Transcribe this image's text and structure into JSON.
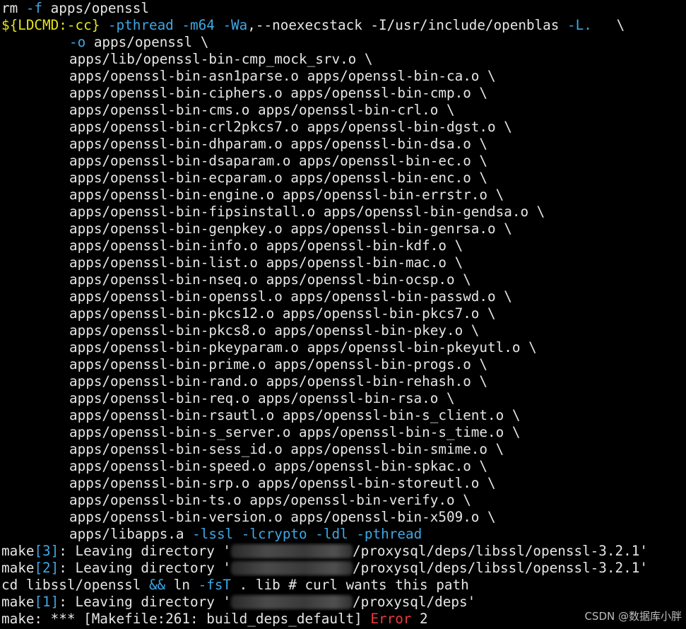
{
  "colors": {
    "background": "#000000",
    "text": "#e6e6e6",
    "flag": "#3ea8e5",
    "variable": "#e5e51a",
    "error": "#e8393c"
  },
  "line1": {
    "cmd": "rm",
    "flag": "-f",
    "arg": "apps/openssl"
  },
  "line2": {
    "var": "${LDCMD:-cc}",
    "flag1": "-pthread",
    "flag2": "-m64",
    "flag3": "-Wa",
    "mid": ",--noexecstack -I/usr/include/openblas ",
    "flag4": "-L.",
    "tail": "   \\"
  },
  "line3": {
    "flag": "-o",
    "rest": " apps/openssl \\"
  },
  "objects": [
    "apps/lib/openssl-bin-cmp_mock_srv.o \\",
    "apps/openssl-bin-asn1parse.o apps/openssl-bin-ca.o \\",
    "apps/openssl-bin-ciphers.o apps/openssl-bin-cmp.o \\",
    "apps/openssl-bin-cms.o apps/openssl-bin-crl.o \\",
    "apps/openssl-bin-crl2pkcs7.o apps/openssl-bin-dgst.o \\",
    "apps/openssl-bin-dhparam.o apps/openssl-bin-dsa.o \\",
    "apps/openssl-bin-dsaparam.o apps/openssl-bin-ec.o \\",
    "apps/openssl-bin-ecparam.o apps/openssl-bin-enc.o \\",
    "apps/openssl-bin-engine.o apps/openssl-bin-errstr.o \\",
    "apps/openssl-bin-fipsinstall.o apps/openssl-bin-gendsa.o \\",
    "apps/openssl-bin-genpkey.o apps/openssl-bin-genrsa.o \\",
    "apps/openssl-bin-info.o apps/openssl-bin-kdf.o \\",
    "apps/openssl-bin-list.o apps/openssl-bin-mac.o \\",
    "apps/openssl-bin-nseq.o apps/openssl-bin-ocsp.o \\",
    "apps/openssl-bin-openssl.o apps/openssl-bin-passwd.o \\",
    "apps/openssl-bin-pkcs12.o apps/openssl-bin-pkcs7.o \\",
    "apps/openssl-bin-pkcs8.o apps/openssl-bin-pkey.o \\",
    "apps/openssl-bin-pkeyparam.o apps/openssl-bin-pkeyutl.o \\",
    "apps/openssl-bin-prime.o apps/openssl-bin-progs.o \\",
    "apps/openssl-bin-rand.o apps/openssl-bin-rehash.o \\",
    "apps/openssl-bin-req.o apps/openssl-bin-rsa.o \\",
    "apps/openssl-bin-rsautl.o apps/openssl-bin-s_client.o \\",
    "apps/openssl-bin-s_server.o apps/openssl-bin-s_time.o \\",
    "apps/openssl-bin-sess_id.o apps/openssl-bin-smime.o \\",
    "apps/openssl-bin-speed.o apps/openssl-bin-spkac.o \\",
    "apps/openssl-bin-srp.o apps/openssl-bin-storeutl.o \\",
    "apps/openssl-bin-ts.o apps/openssl-bin-verify.o \\",
    "apps/openssl-bin-version.o apps/openssl-bin-x509.o \\"
  ],
  "libline": {
    "lib": "apps/libapps.a ",
    "f1": "-lssl",
    "f2": "-lcrypto",
    "f3": "-ldl",
    "f4": "-pthread"
  },
  "make3": {
    "pre": "make",
    "num": "[3]",
    "mid": ": Leaving directory '",
    "path": "/proxysql/deps/libssl/openssl-3.2.1'"
  },
  "make2": {
    "pre": "make",
    "num": "[2]",
    "mid": ": Leaving directory '",
    "path": "/proxysql/deps/libssl/openssl-3.2.1'"
  },
  "cdline": {
    "pre": "cd libssl/openssl ",
    "and": "&&",
    "ln": " ln ",
    "flag": "-fsT",
    "rest": " . lib # curl wants this path"
  },
  "make1": {
    "pre": "make",
    "num": "[1]",
    "mid": ": Leaving directory '",
    "path": "/proxysql/deps'"
  },
  "lastline": {
    "pre": "make: *** [Makefile:261: build_deps_default] ",
    "err": "Error",
    "code": " 2"
  },
  "watermark": "CSDN @数据库小胖"
}
